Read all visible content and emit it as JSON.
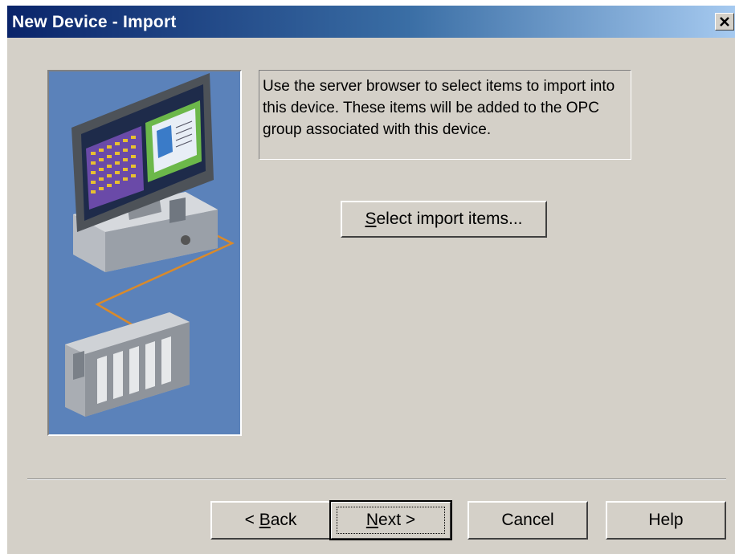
{
  "window": {
    "title": "New Device - Import",
    "close_glyph": "✕"
  },
  "description": "Use the server browser to select items to import into this device. These items will be added to the OPC group associated with this device.",
  "buttons": {
    "select_import": {
      "accel": "S",
      "rest": "elect import items..."
    },
    "back": {
      "prefix": "< ",
      "accel": "B",
      "rest": "ack"
    },
    "next": {
      "accel": "N",
      "rest": "ext >"
    },
    "cancel": "Cancel",
    "help": "Help"
  },
  "illustration": {
    "icon": "computer-plc-network-illustration"
  },
  "colors": {
    "title_start": "#0a246a",
    "title_end": "#a6caf0",
    "dialog_bg": "#d4d0c8",
    "panel_bg": "#5a80b8"
  }
}
